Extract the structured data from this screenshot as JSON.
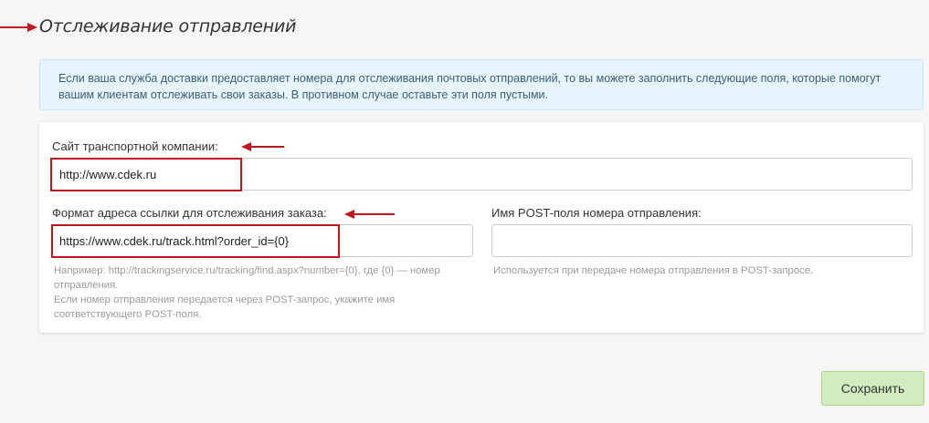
{
  "page": {
    "title": "Отслеживание отправлений"
  },
  "info": {
    "text": "Если ваша служба доставки предоставляет номера для отслеживания почтовых отправлений, то вы можете заполнить следующие поля, которые помогут вашим клиентам отслеживать свои заказы. В противном случае оставьте эти поля пустыми."
  },
  "form": {
    "company_site": {
      "label": "Сайт транспортной компании:",
      "value": "http://www.cdek.ru"
    },
    "tracking_url": {
      "label": "Формат адреса ссылки для отслеживания заказа:",
      "value": "https://www.cdek.ru/track.html?order_id={0}",
      "help_line1": "Например: http://trackingservice.ru/tracking/find.aspx?number={0}, где {0} — номер отправления.",
      "help_line2": "Если номер отправления передается через POST-запрос, укажите имя соответствующего POST-поля."
    },
    "post_field": {
      "label": "Имя POST-поля номера отправления:",
      "value": "",
      "help": "Используется при передаче номера отправления в POST-запросе."
    }
  },
  "actions": {
    "save_label": "Сохранить"
  },
  "colors": {
    "annotation_red": "#c0161f",
    "info_bg": "#e8f4fb",
    "save_bg": "#d2ecbf"
  }
}
